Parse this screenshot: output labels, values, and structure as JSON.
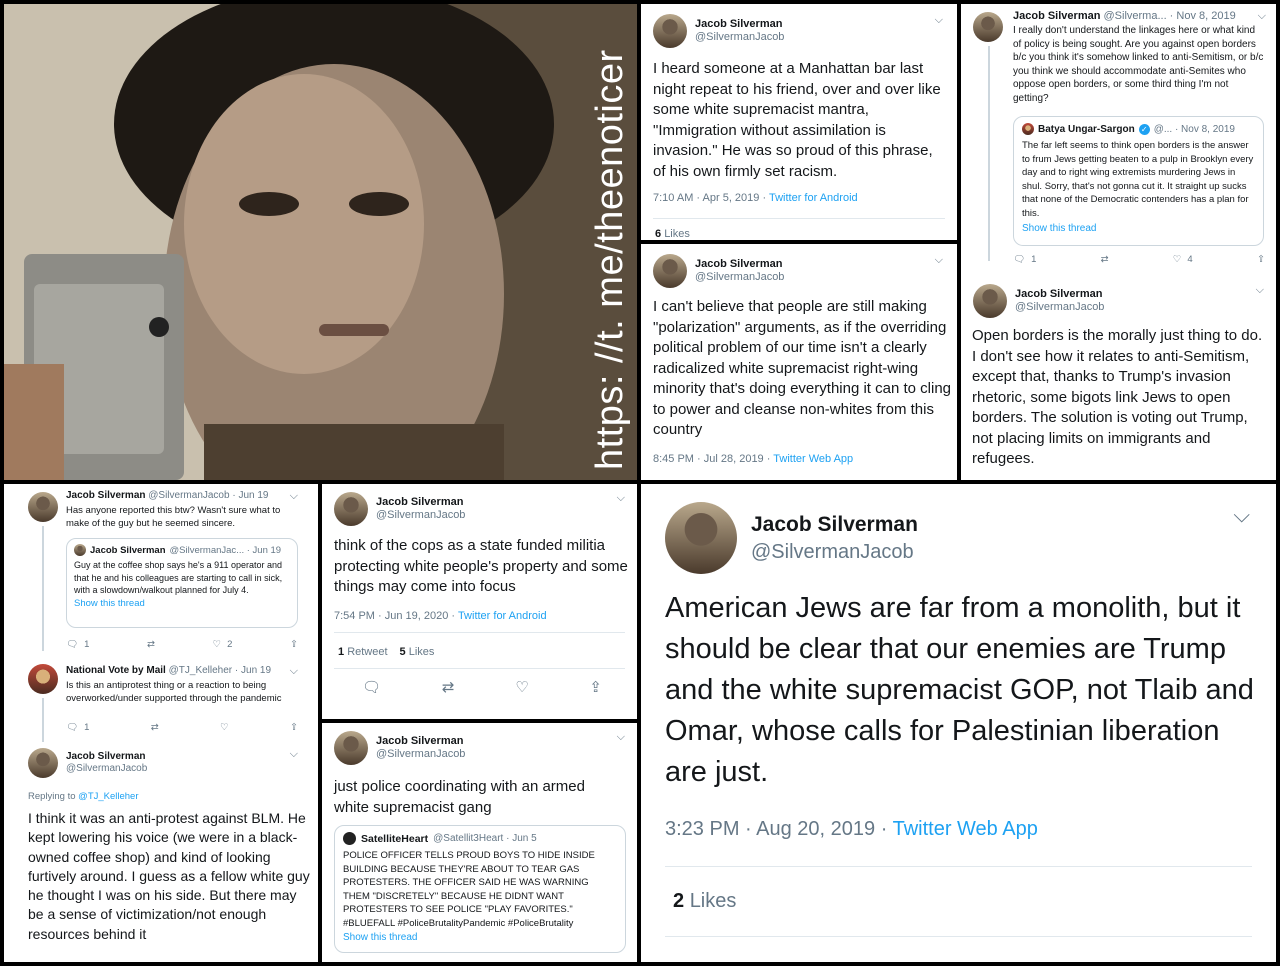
{
  "watermark": "https: //t. me/theenoticer",
  "panel_a": {
    "name": "Jacob Silverman",
    "handle": "@SilvermanJacob",
    "text": "I heard someone at a Manhattan bar last night repeat to his friend, over and over like some white supremacist mantra, \"Immigration without assimilation is invasion.\" He was so proud of this phrase, of his own firmly set racism.",
    "time": "7:10 AM · Apr 5, 2019 ·",
    "source": "Twitter for Android",
    "likes_count": "6",
    "likes_label": "Likes"
  },
  "panel_b": {
    "name": "Jacob Silverman",
    "handle": "@SilvermanJacob",
    "text": "I can't believe that people are still making \"polarization\" arguments, as if the overriding political problem of our time isn't a clearly radicalized white supremacist right-wing minority that's doing everything it can to cling to power and cleanse non-whites from this country",
    "time": "8:45 PM · Jul 28, 2019 ·",
    "source": "Twitter Web App"
  },
  "panel_c": {
    "reply": {
      "name": "Jacob Silverman",
      "handle_date": "@Silverma... · Nov 8, 2019",
      "text": "I really don't understand the linkages here or what kind of policy is being sought. Are you against open borders b/c you think it's somehow linked to anti-Semitism, or b/c you think we should accommodate anti-Semites who oppose open borders, or some third thing I'm not getting?"
    },
    "quote": {
      "name": "Batya Ungar-Sargon",
      "handle_date": "@... · Nov 8, 2019",
      "text": "The far left seems to think open borders is the answer to frum Jews getting beaten to a pulp in Brooklyn every day and to right wing extremists murdering Jews in shul. Sorry, that's not gonna cut it. It straight up sucks that none of the Democratic contenders has a plan for this.",
      "show_thread": "Show this thread"
    },
    "actions": {
      "replies": "1",
      "likes": "4"
    },
    "main": {
      "name": "Jacob Silverman",
      "handle": "@SilvermanJacob",
      "text": "Open borders is the morally just thing to do. I don't see how it relates to anti-Semitism, except that, thanks to Trump's invasion rhetoric, some bigots link Jews to open borders. The solution is voting out Trump, not placing limits on immigrants and refugees."
    }
  },
  "panel_d": {
    "t1": {
      "name": "Jacob Silverman",
      "handle_date": "@SilvermanJacob · Jun 19",
      "text": "Has anyone reported this btw? Wasn't sure what to make of the guy but he seemed sincere."
    },
    "quote": {
      "name": "Jacob Silverman",
      "handle_date": "@SilvermanJac... · Jun 19",
      "text": "Guy at the coffee shop says he's a 911 operator and that he and his colleagues are starting to call in sick, with a slowdown/walkout planned for July 4.",
      "show_thread": "Show this thread"
    },
    "t1_actions": {
      "replies": "1",
      "likes": "2"
    },
    "t2": {
      "name": "National Vote by Mail",
      "handle_date": "@TJ_Kelleher · Jun 19",
      "text": "Is this an antiprotest thing or a reaction to being overworked/under supported through the pandemic"
    },
    "t2_actions": {
      "replies": "1"
    },
    "t3": {
      "name": "Jacob Silverman",
      "handle": "@SilvermanJacob",
      "replying_prefix": "Replying to",
      "replying_to": "@TJ_Kelleher",
      "text": "I think it was an anti-protest against BLM. He kept lowering his voice (we were in a black-owned coffee shop) and kind of looking furtively around. I guess as a fellow white guy he thought I was on his side. But there may be a sense of victimization/not enough resources behind it"
    }
  },
  "panel_e": {
    "name": "Jacob Silverman",
    "handle": "@SilvermanJacob",
    "text": "think of the cops as a state funded militia protecting white people's property and some things may come into focus",
    "time": "7:54 PM · Jun 19, 2020 ·",
    "source": "Twitter for Android",
    "retweets_count": "1",
    "retweets_label": "Retweet",
    "likes_count": "5",
    "likes_label": "Likes"
  },
  "panel_f": {
    "name": "Jacob Silverman",
    "handle": "@SilvermanJacob",
    "text": "just police coordinating with an armed white supremacist gang",
    "quote": {
      "name": "SatelliteHeart",
      "handle_date": "@Satellit3Heart · Jun 5",
      "text": "POLICE OFFICER TELLS PROUD BOYS TO HIDE INSIDE BUILDING BECAUSE THEY'RE ABOUT TO TEAR GAS PROTESTERS. THE OFFICER SAID HE WAS WARNING THEM \"DISCRETELY\" BECAUSE HE DIDNT WANT PROTESTERS TO SEE POLICE \"PLAY FAVORITES.\" #BLUEFALL #PoliceBrutalityPandemic #PoliceBrutality",
      "show_thread": "Show this thread"
    }
  },
  "panel_g": {
    "name": "Jacob Silverman",
    "handle": "@SilvermanJacob",
    "text": "American Jews are far from a monolith, but it should be clear that our enemies are Trump and the white supremacist GOP, not Tlaib and Omar, whose calls for Palestinian liberation are just.",
    "time": "3:23 PM · Aug 20, 2019 ·",
    "source": "Twitter Web App",
    "likes_count": "2",
    "likes_label": "Likes"
  }
}
